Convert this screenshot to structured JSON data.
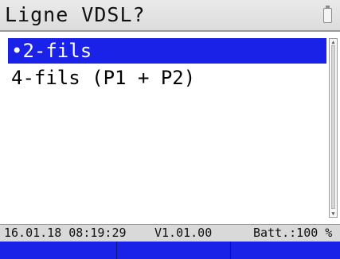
{
  "window": {
    "title": "Ligne VDSL?",
    "battery_icon": "battery-icon"
  },
  "menu": {
    "items": [
      {
        "label": "•2-fils",
        "selected": true
      },
      {
        "label": "4-fils (P1 + P2)",
        "selected": false
      }
    ]
  },
  "status": {
    "datetime": "16.01.18 08:19:29",
    "version": "V1.01.00",
    "battery": "Batt.:100 %"
  },
  "softkeys": [
    "",
    "",
    ""
  ],
  "colors": {
    "accent": "#1a22e8",
    "title_bg": "#e0e0e0",
    "status_bg": "#d9d9d9"
  }
}
